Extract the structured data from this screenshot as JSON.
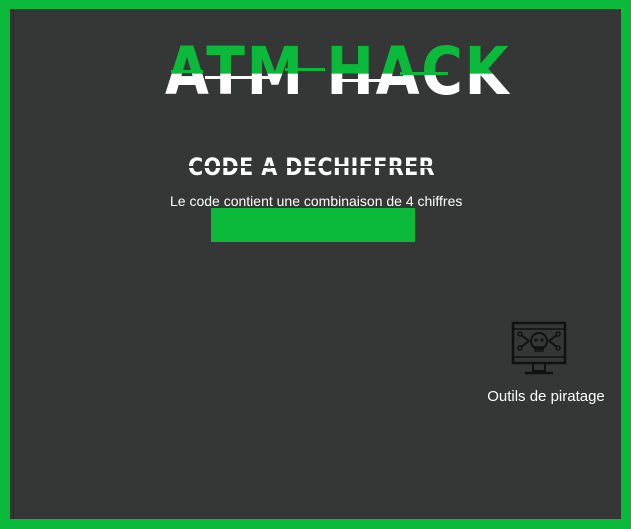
{
  "app": {
    "title": "ATM HACK"
  },
  "challenge": {
    "heading": "CODE A DECHIFFRER",
    "hint": "Le code contient une combinaison de 4 chiffres",
    "code_value": "",
    "code_placeholder": ""
  },
  "tools": {
    "label": "Outils de piratage",
    "icon": "hacker-skull-monitor-icon"
  },
  "colors": {
    "accent": "#0bba3a",
    "background": "#353636",
    "text": "#ffffff"
  }
}
